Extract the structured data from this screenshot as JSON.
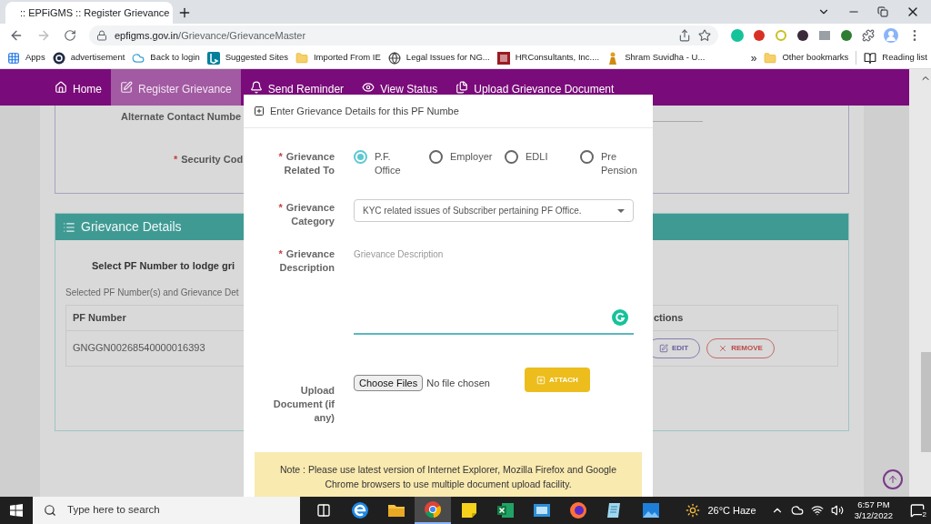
{
  "browser": {
    "tab_title": ":: EPFiGMS :: Register Grievance",
    "url_host": "epfigms.gov.in",
    "url_path": "/Grievance/GrievanceMaster",
    "bookmarks": [
      {
        "kind": "apps",
        "label": "Apps"
      },
      {
        "kind": "q",
        "label": "advertisement"
      },
      {
        "kind": "cloud",
        "label": "Back to login"
      },
      {
        "kind": "b",
        "label": "Suggested Sites"
      },
      {
        "kind": "folder",
        "label": "Imported From IE"
      },
      {
        "kind": "globe",
        "label": "Legal Issues for NG..."
      },
      {
        "kind": "hr",
        "label": "HRConsultants, Inc...."
      },
      {
        "kind": "figure",
        "label": "Shram Suvidha - U..."
      }
    ],
    "overflow": "»",
    "other_bookmarks": "Other bookmarks",
    "reading_list": "Reading list"
  },
  "nav": [
    {
      "kind": "home",
      "label": "Home",
      "selected": false
    },
    {
      "kind": "edit",
      "label": "Register Grievance",
      "selected": true
    },
    {
      "kind": "bell",
      "label": "Send Reminder",
      "selected": false
    },
    {
      "kind": "eye",
      "label": "View Status",
      "selected": false
    },
    {
      "kind": "upload",
      "label": "Upload Grievance Document",
      "selected": false
    }
  ],
  "background": {
    "alt_contact_label": "Alternate Contact Numbe",
    "security_label": "Security Cod",
    "required_mark": "*",
    "section_title": "Grievance Details",
    "select_prompt": "Select PF Number to lodge gri",
    "selected_caption": "Selected PF Number(s) and Grievance Det",
    "table": {
      "columns": [
        "PF Number",
        "ctions"
      ],
      "rows": [
        {
          "pf_number": "GNGGN00268540000016393",
          "actions": [
            {
              "kind": "edit",
              "label": "EDIT"
            },
            {
              "kind": "remove",
              "label": "REMOVE"
            }
          ]
        }
      ]
    }
  },
  "modal": {
    "title": "Enter Grievance Details for this PF Numbe",
    "required_mark": "*",
    "related_label": "Grievance Related To",
    "related_options": [
      {
        "label": "P.F. Office",
        "selected": true
      },
      {
        "label": "Employer",
        "selected": false
      },
      {
        "label": "EDLI",
        "selected": false
      },
      {
        "label": "Pre Pension",
        "selected": false
      }
    ],
    "category_label": "Grievance Category",
    "category_value": "KYC related issues of Subscriber pertaining PF Office.",
    "description_label": "Grievance Description",
    "description_placeholder": "Grievance Description",
    "upload_label": "Upload Document (if any)",
    "choose_button": "Choose Files",
    "file_status": "No file chosen",
    "attach_button": "ATTACH",
    "note": "Note : Please use latest version of Internet Explorer, Mozilla Firefox and Google Chrome browsers to use multiple document upload facility."
  },
  "taskbar": {
    "search_placeholder": "Type here to search",
    "apps": [
      {
        "kind": "taskview",
        "selected": false
      },
      {
        "kind": "edge",
        "selected": false
      },
      {
        "kind": "explorer",
        "selected": false
      },
      {
        "kind": "chrome",
        "selected": true
      },
      {
        "kind": "sticky",
        "selected": false
      },
      {
        "kind": "excel",
        "selected": false
      },
      {
        "kind": "mail",
        "selected": false
      },
      {
        "kind": "firefox",
        "selected": false
      },
      {
        "kind": "notepad",
        "selected": false
      },
      {
        "kind": "photos",
        "selected": false
      }
    ],
    "weather": "26°C Haze",
    "time": "6:57 PM",
    "date": "3/12/2022",
    "notifications": "2"
  }
}
